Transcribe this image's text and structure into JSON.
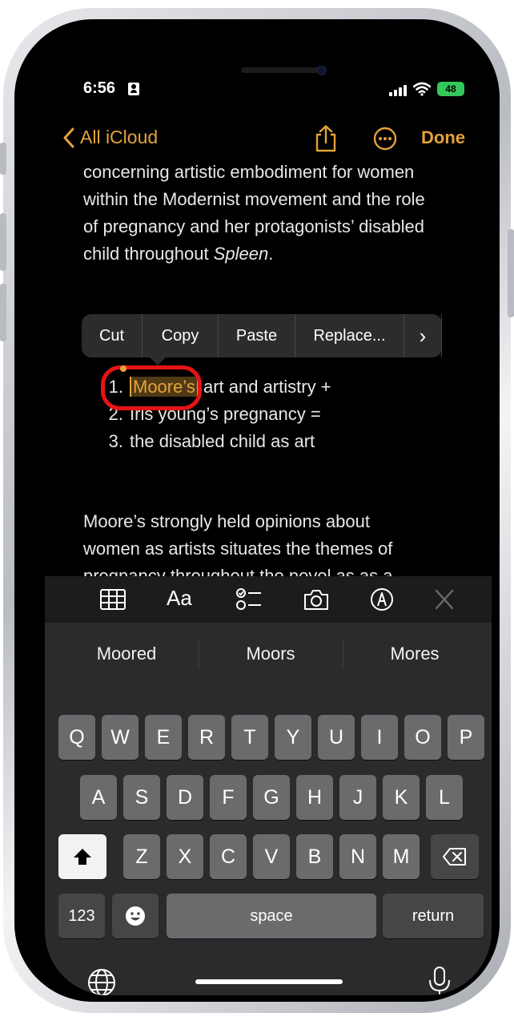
{
  "status": {
    "time": "6:56",
    "battery": "48"
  },
  "nav": {
    "back_label": "All iCloud",
    "done_label": "Done"
  },
  "note": {
    "paragraph1_lines": [
      "concerning artistic embodiment for women",
      "within the Modernist movement and the role",
      "of pregnancy and her protagonists’ disabled"
    ],
    "paragraph1_last": "child throughout ",
    "paragraph1_italic": "Spleen",
    "paragraph1_end": ".",
    "list": [
      {
        "num": "1.",
        "selected": "Moore’s",
        "rest": " art and artistry +"
      },
      {
        "num": "2.",
        "text": "Iris young’s pregnancy ="
      },
      {
        "num": "3.",
        "text": "the disabled child as art"
      }
    ],
    "paragraph2_lines": [
      "Moore’s strongly held opinions about",
      "women as artists situates the themes of",
      "pregnancy throughout the novel as as a"
    ]
  },
  "edit_menu": {
    "cut": "Cut",
    "copy": "Copy",
    "paste": "Paste",
    "replace": "Replace...",
    "more": "›"
  },
  "toolbar": {
    "format_label": "Aa"
  },
  "suggestions": [
    "Moored",
    "Moors",
    "Mores"
  ],
  "keyboard": {
    "row1": [
      "Q",
      "W",
      "E",
      "R",
      "T",
      "Y",
      "U",
      "I",
      "O",
      "P"
    ],
    "row2": [
      "A",
      "S",
      "D",
      "F",
      "G",
      "H",
      "J",
      "K",
      "L"
    ],
    "row3": [
      "Z",
      "X",
      "C",
      "V",
      "B",
      "N",
      "M"
    ],
    "numbers_label": "123",
    "space_label": "space",
    "return_label": "return"
  },
  "colors": {
    "accent": "#e5a33b",
    "highlight_circle": "#e61414",
    "battery": "#34c759"
  }
}
